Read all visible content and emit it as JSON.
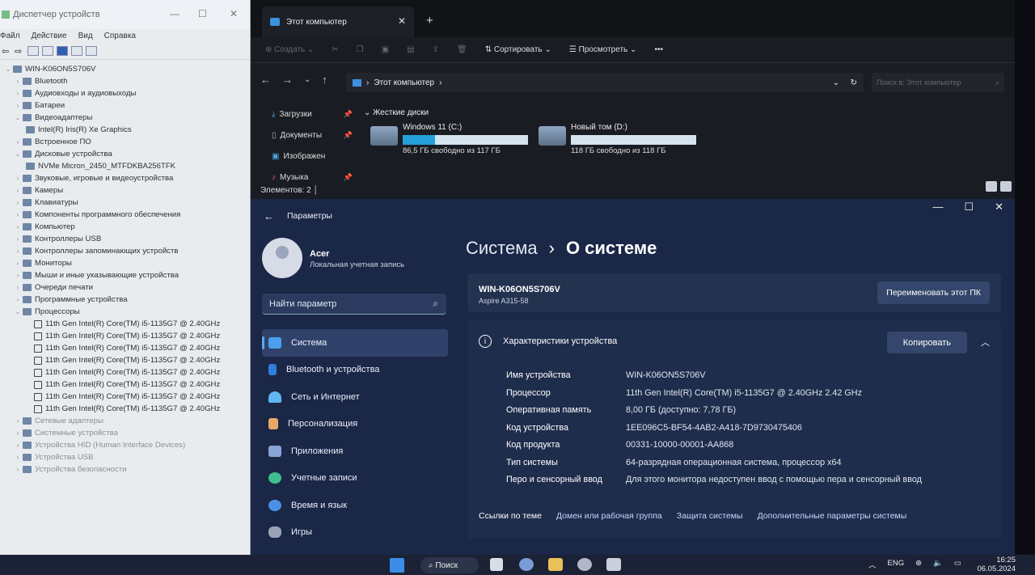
{
  "devmgr": {
    "title": "Диспетчер устройств",
    "menu": [
      "Файл",
      "Действие",
      "Вид",
      "Справка"
    ],
    "tree": [
      {
        "label": "WIN-K06ON5S706V",
        "level": 0,
        "expanded": true
      },
      {
        "label": "Bluetooth",
        "level": 1
      },
      {
        "label": "Аудиовходы и аудиовыходы",
        "level": 1
      },
      {
        "label": "Батареи",
        "level": 1
      },
      {
        "label": "Видеоадаптеры",
        "level": 1,
        "expanded": true
      },
      {
        "label": "Intel(R) Iris(R) Xe Graphics",
        "level": 2
      },
      {
        "label": "Встроенное ПО",
        "level": 1
      },
      {
        "label": "Дисковые устройства",
        "level": 1,
        "expanded": true
      },
      {
        "label": "NVMe Micron_2450_MTFDKBA256TFK",
        "level": 2
      },
      {
        "label": "Звуковые, игровые и видеоустройства",
        "level": 1
      },
      {
        "label": "Камеры",
        "level": 1
      },
      {
        "label": "Клавиатуры",
        "level": 1
      },
      {
        "label": "Компоненты программного обеспечения",
        "level": 1
      },
      {
        "label": "Компьютер",
        "level": 1
      },
      {
        "label": "Контроллеры USB",
        "level": 1
      },
      {
        "label": "Контроллеры запоминающих устройств",
        "level": 1
      },
      {
        "label": "Мониторы",
        "level": 1
      },
      {
        "label": "Мыши и иные указывающие устройства",
        "level": 1
      },
      {
        "label": "Очереди печати",
        "level": 1
      },
      {
        "label": "Программные устройства",
        "level": 1
      },
      {
        "label": "Процессоры",
        "level": 1,
        "expanded": true
      },
      {
        "label": "11th Gen Intel(R) Core(TM) i5-1135G7 @ 2.40GHz",
        "level": 3
      },
      {
        "label": "11th Gen Intel(R) Core(TM) i5-1135G7 @ 2.40GHz",
        "level": 3
      },
      {
        "label": "11th Gen Intel(R) Core(TM) i5-1135G7 @ 2.40GHz",
        "level": 3
      },
      {
        "label": "11th Gen Intel(R) Core(TM) i5-1135G7 @ 2.40GHz",
        "level": 3
      },
      {
        "label": "11th Gen Intel(R) Core(TM) i5-1135G7 @ 2.40GHz",
        "level": 3
      },
      {
        "label": "11th Gen Intel(R) Core(TM) i5-1135G7 @ 2.40GHz",
        "level": 3
      },
      {
        "label": "11th Gen Intel(R) Core(TM) i5-1135G7 @ 2.40GHz",
        "level": 3
      },
      {
        "label": "11th Gen Intel(R) Core(TM) i5-1135G7 @ 2.40GHz",
        "level": 3
      },
      {
        "label": "Сетевые адаптеры",
        "level": 1
      },
      {
        "label": "Системные устройства",
        "level": 1
      },
      {
        "label": "Устройства HID (Human Interface Devices)",
        "level": 1
      },
      {
        "label": "Устройства USB",
        "level": 1
      },
      {
        "label": "Устройства безопасности",
        "level": 1
      }
    ]
  },
  "explorer": {
    "tab_title": "Этот компьютер",
    "commands": {
      "create": "Создать",
      "sort": "Сортировать",
      "view": "Просмотреть",
      "more": "•••"
    },
    "address": "Этот компьютер",
    "search_placeholder": "Поиск в: Этот компьютер",
    "nav": [
      "Загрузки",
      "Документы",
      "Изображен",
      "Музыка"
    ],
    "group": "Жесткие диски",
    "drives": [
      {
        "name": "Windows 11 (C:)",
        "free": "86,5 ГБ свободно из 117 ГБ",
        "used_fraction": 0.26
      },
      {
        "name": "Новый том (D:)",
        "free": "118 ГБ свободно из 118 ГБ",
        "used_fraction": 0.0
      }
    ],
    "status": "Элементов: 2"
  },
  "settings": {
    "title": "Параметры",
    "user": "Acer",
    "account": "Локальная учетная запись",
    "find_placeholder": "Найти параметр",
    "menu": [
      "Система",
      "Bluetooth и устройства",
      "Сеть и Интернет",
      "Персонализация",
      "Приложения",
      "Учетные записи",
      "Время и язык",
      "Игры"
    ],
    "breadcrumb": {
      "parent": "Система",
      "sep": "›",
      "current": "О системе"
    },
    "pc_name": "WIN-K06ON5S706V",
    "pc_model": "Aspire A315-58",
    "rename_button": "Переименовать этот ПК",
    "specs_header": "Характеристики устройства",
    "copy_button": "Копировать",
    "specs": [
      {
        "key": "Имя устройства",
        "value": "WIN-K06ON5S706V"
      },
      {
        "key": "Процессор",
        "value": "11th Gen Intel(R) Core(TM) i5-1135G7 @ 2.40GHz   2.42 GHz"
      },
      {
        "key": "Оперативная память",
        "value": "8,00 ГБ (доступно: 7,78 ГБ)"
      },
      {
        "key": "Код устройства",
        "value": "1EE096C5-BF54-4AB2-A418-7D9730475406"
      },
      {
        "key": "Код продукта",
        "value": "00331-10000-00001-AA868"
      },
      {
        "key": "Тип системы",
        "value": "64-разрядная операционная система, процессор x64"
      },
      {
        "key": "Перо и сенсорный ввод",
        "value": "Для этого монитора недоступен ввод с помощью пера и сенсорный ввод"
      }
    ],
    "links_label": "Ссылки по теме",
    "links": [
      "Домен или рабочая группа",
      "Защита системы",
      "Дополнительные параметры системы"
    ]
  },
  "taskbar": {
    "search": "Поиск",
    "lang": "ENG",
    "time": "16:25",
    "date": "06.05.2024"
  },
  "colors": {
    "accent": "#26a0da",
    "settings_bg": "#1a2746",
    "explorer_bg": "#191c22"
  }
}
